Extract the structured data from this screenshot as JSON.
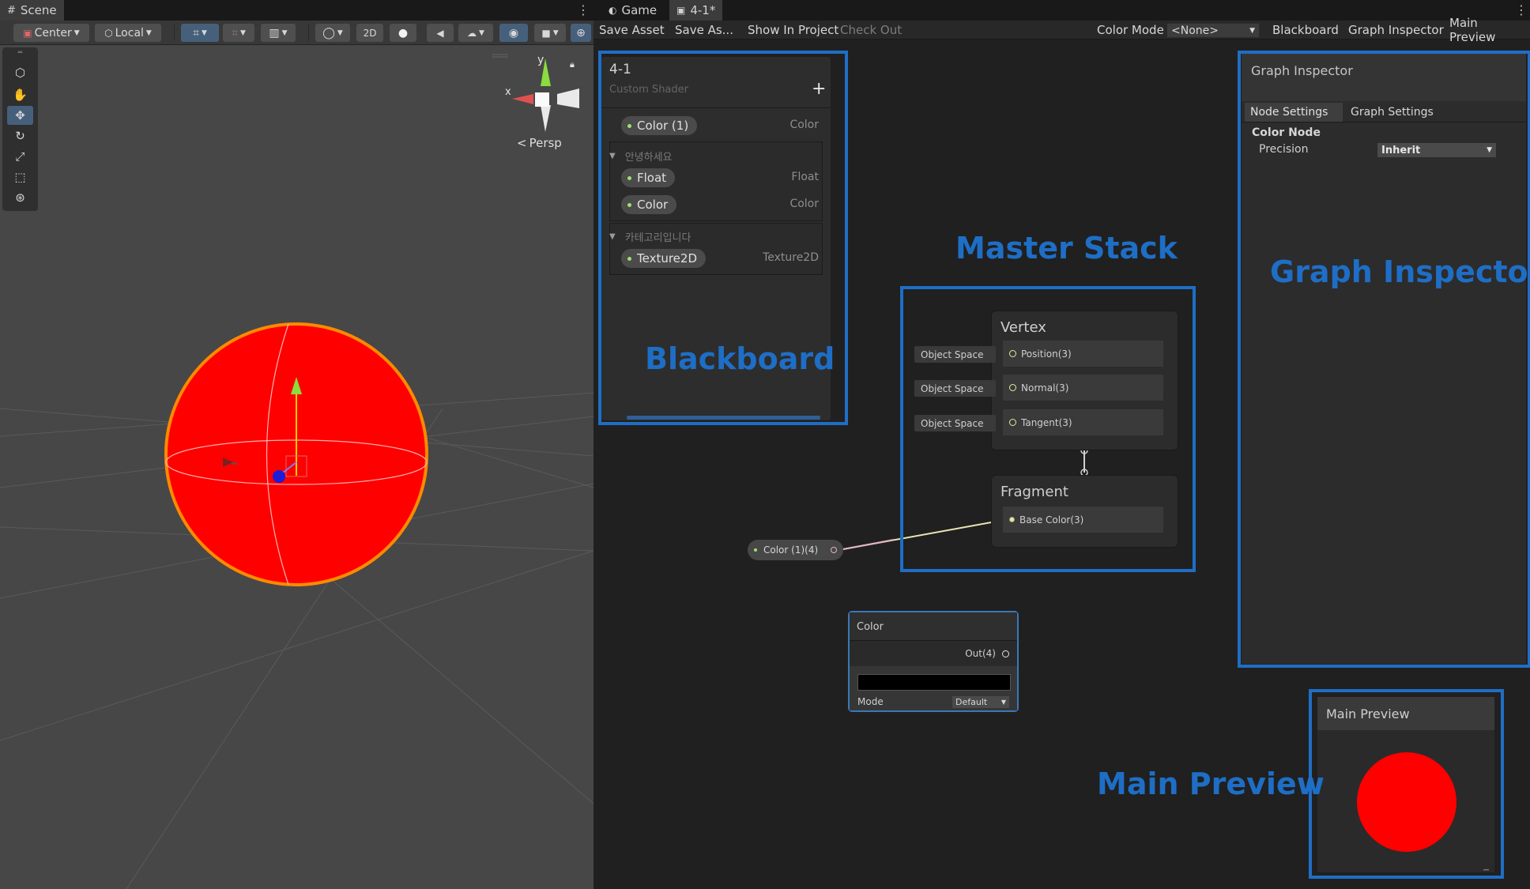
{
  "scene": {
    "tab_label": "Scene",
    "toolbar": {
      "pivot_label": "Center",
      "space_label": "Local",
      "mode_2d_label": "2D"
    },
    "gizmo": {
      "axis_y": "y",
      "axis_x": "x",
      "projection_label": "Persp"
    },
    "sphere_color": "#ff0000",
    "selection_color": "#4f7fc1"
  },
  "shader_graph": {
    "tabs": [
      "Game",
      "4-1*"
    ],
    "toolbar": {
      "save_asset": "Save Asset",
      "save_as": "Save As...",
      "show_in_project": "Show In Project",
      "check_out": "Check Out",
      "color_mode_label": "Color Mode",
      "color_mode_value": "<None>",
      "blackboard": "Blackboard",
      "graph_inspector": "Graph Inspector",
      "main_preview": "Main Preview"
    },
    "blackboard": {
      "title": "4-1",
      "subtitle": "Custom Shader",
      "add_symbol": "+",
      "properties": [
        {
          "name": "Color (1)",
          "type": "Color"
        }
      ],
      "categories": [
        {
          "name": "안녕하세요",
          "properties": [
            {
              "name": "Float",
              "type": "Float"
            },
            {
              "name": "Color",
              "type": "Color"
            }
          ]
        },
        {
          "name": "카테고리입니다",
          "properties": [
            {
              "name": "Texture2D",
              "type": "Texture2D"
            }
          ]
        }
      ]
    },
    "master_stack": {
      "vertex": {
        "title": "Vertex",
        "slots": [
          {
            "label": "Position(3)",
            "input": "Object Space"
          },
          {
            "label": "Normal(3)",
            "input": "Object Space"
          },
          {
            "label": "Tangent(3)",
            "input": "Object Space"
          }
        ]
      },
      "fragment": {
        "title": "Fragment",
        "slots": [
          {
            "label": "Base Color(3)"
          }
        ]
      }
    },
    "property_node": {
      "label": "Color (1)(4)"
    },
    "color_node": {
      "title": "Color",
      "output": "Out(4)",
      "swatch": "#000000",
      "mode_label": "Mode",
      "mode_value": "Default"
    },
    "graph_inspector": {
      "title": "Graph Inspector",
      "tabs": [
        "Node Settings",
        "Graph Settings"
      ],
      "section": "Color Node",
      "precision_label": "Precision",
      "precision_value": "Inherit"
    },
    "main_preview": {
      "title": "Main Preview",
      "preview_color": "#ff0000"
    },
    "annotations": {
      "blackboard": "Blackboard",
      "master_stack": "Master Stack",
      "graph_inspector": "Graph Inspector",
      "main_preview": "Main Preview",
      "color": "#1f6ec6"
    },
    "edge_color": "#e8e6b4"
  }
}
